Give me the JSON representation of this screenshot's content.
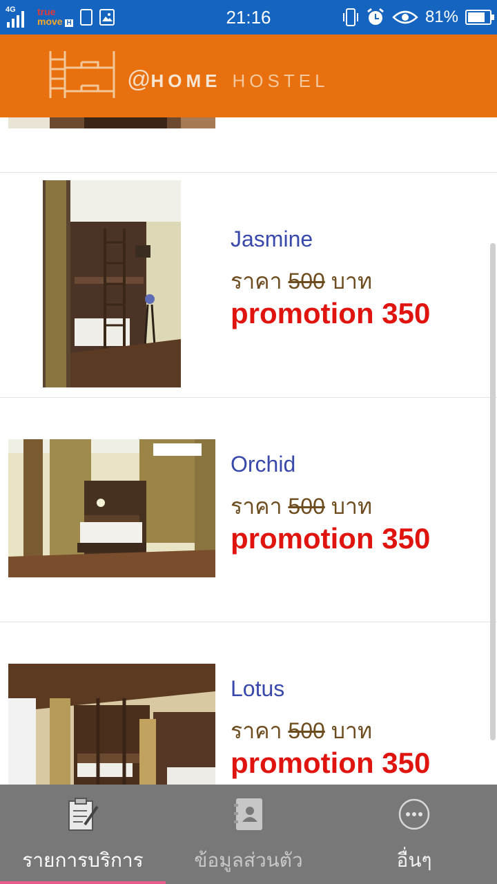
{
  "status_bar": {
    "network": "4G",
    "carrier_line1": "true",
    "carrier_line2": "move",
    "carrier_badge": "H",
    "time": "21:16",
    "battery_percent": "81%",
    "battery_level": 0.81,
    "icons": [
      "signal-icon",
      "sim-icon",
      "image-icon",
      "vibrate-icon",
      "alarm-icon",
      "eye-icon",
      "battery-icon"
    ]
  },
  "header": {
    "logo_at": "@",
    "logo_home": "HOME",
    "logo_hostel": "HOSTEL",
    "logo_icon": "bunk-bed-logo-icon",
    "background": "#e8700e"
  },
  "rooms": [
    {
      "name": "Jasmine",
      "price_prefix": "ราคา",
      "price_old": "500",
      "price_unit": "บาท",
      "promotion": "promotion 350"
    },
    {
      "name": "Orchid",
      "price_prefix": "ราคา",
      "price_old": "500",
      "price_unit": "บาท",
      "promotion": "promotion 350"
    },
    {
      "name": "Lotus",
      "price_prefix": "ราคา",
      "price_old": "500",
      "price_unit": "บาท",
      "promotion": "promotion 350"
    }
  ],
  "bottom_nav": {
    "tabs": [
      {
        "label": "รายการบริการ",
        "icon": "checklist-icon",
        "active": true
      },
      {
        "label": "ข้อมูลส่วนตัว",
        "icon": "contact-book-icon",
        "active": false
      },
      {
        "label": "อื่นๆ",
        "icon": "more-icon",
        "active": false
      }
    ],
    "active_color": "#e85a8a"
  },
  "colors": {
    "status_bar": "#1565c0",
    "room_name": "#3949ab",
    "price": "#6d4c1f",
    "promotion": "#e0140f",
    "nav_bg": "#787878"
  }
}
